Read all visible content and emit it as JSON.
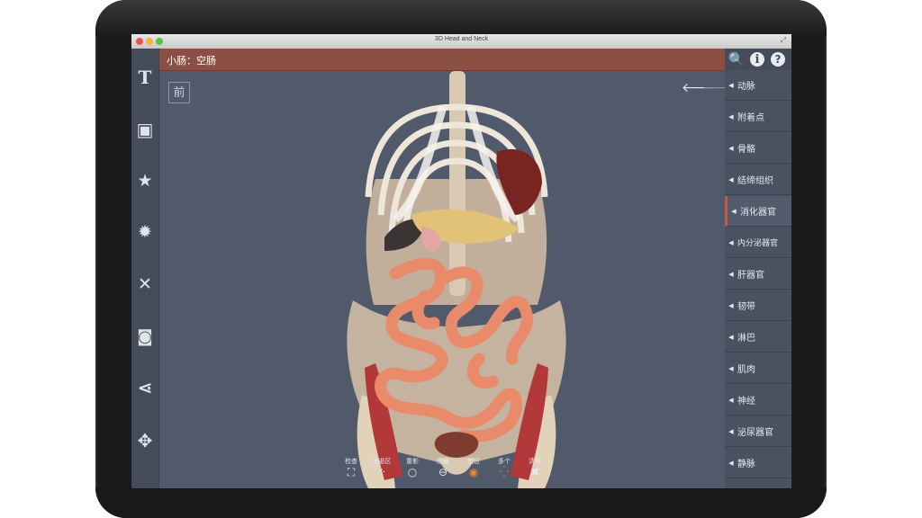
{
  "window": {
    "title": "3D Head and Neck",
    "resize_glyph": "⤢"
  },
  "header": {
    "title": "小肠：空肠"
  },
  "view": {
    "orientation_label": "前",
    "back_arrow": "🡐",
    "forward_arrow": "🡒"
  },
  "left_toolbar": [
    {
      "icon": "text-icon",
      "glyph": "T"
    },
    {
      "icon": "frame-icon",
      "glyph": "▣"
    },
    {
      "icon": "star-icon",
      "glyph": "★"
    },
    {
      "icon": "gear-icon",
      "glyph": "✹"
    },
    {
      "icon": "tools-icon",
      "glyph": "✕"
    },
    {
      "icon": "camera-icon",
      "glyph": "◙"
    },
    {
      "icon": "share-icon",
      "glyph": "⋖"
    },
    {
      "icon": "move-icon",
      "glyph": "✥"
    }
  ],
  "top_icons": [
    {
      "icon": "search-icon",
      "glyph": "🔍"
    },
    {
      "icon": "info-icon",
      "glyph": "i"
    },
    {
      "icon": "help-icon",
      "glyph": "?"
    }
  ],
  "systems": [
    {
      "label": "动脉"
    },
    {
      "label": "附着点"
    },
    {
      "label": "骨骼"
    },
    {
      "label": "结缔组织"
    },
    {
      "label": "消化器官",
      "active": true
    },
    {
      "label": "内分泌器官"
    },
    {
      "label": "肝器官"
    },
    {
      "label": "韧带"
    },
    {
      "label": "淋巴"
    },
    {
      "label": "肌肉"
    },
    {
      "label": "神经"
    },
    {
      "label": "泌尿器官"
    },
    {
      "label": "静脉"
    }
  ],
  "bottom_tools": [
    {
      "label": "检查",
      "glyph": "⛶"
    },
    {
      "label": "消逝区",
      "glyph": "⁘"
    },
    {
      "label": "重影",
      "glyph": "○"
    },
    {
      "label": "隐藏",
      "glyph": "⊖"
    },
    {
      "label": "炮位",
      "glyph": "◉"
    },
    {
      "label": "多个",
      "glyph": "⁛"
    },
    {
      "label": "清除",
      "glyph": "✖"
    }
  ],
  "colors": {
    "header": "#8c4f44",
    "active_marker": "#c25a44",
    "intestine": "#e98a6a",
    "orange_tool": "#f08a30"
  }
}
